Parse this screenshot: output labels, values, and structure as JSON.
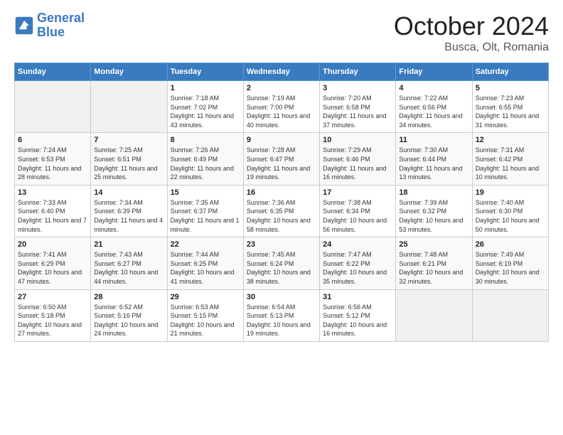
{
  "header": {
    "logo_line1": "General",
    "logo_line2": "Blue",
    "title": "October 2024",
    "subtitle": "Busca, Olt, Romania"
  },
  "days_of_week": [
    "Sunday",
    "Monday",
    "Tuesday",
    "Wednesday",
    "Thursday",
    "Friday",
    "Saturday"
  ],
  "weeks": [
    [
      {
        "num": "",
        "info": ""
      },
      {
        "num": "",
        "info": ""
      },
      {
        "num": "1",
        "info": "Sunrise: 7:18 AM\nSunset: 7:02 PM\nDaylight: 11 hours and 43 minutes."
      },
      {
        "num": "2",
        "info": "Sunrise: 7:19 AM\nSunset: 7:00 PM\nDaylight: 11 hours and 40 minutes."
      },
      {
        "num": "3",
        "info": "Sunrise: 7:20 AM\nSunset: 6:58 PM\nDaylight: 11 hours and 37 minutes."
      },
      {
        "num": "4",
        "info": "Sunrise: 7:22 AM\nSunset: 6:56 PM\nDaylight: 11 hours and 34 minutes."
      },
      {
        "num": "5",
        "info": "Sunrise: 7:23 AM\nSunset: 6:55 PM\nDaylight: 11 hours and 31 minutes."
      }
    ],
    [
      {
        "num": "6",
        "info": "Sunrise: 7:24 AM\nSunset: 6:53 PM\nDaylight: 11 hours and 28 minutes."
      },
      {
        "num": "7",
        "info": "Sunrise: 7:25 AM\nSunset: 6:51 PM\nDaylight: 11 hours and 25 minutes."
      },
      {
        "num": "8",
        "info": "Sunrise: 7:26 AM\nSunset: 6:49 PM\nDaylight: 11 hours and 22 minutes."
      },
      {
        "num": "9",
        "info": "Sunrise: 7:28 AM\nSunset: 6:47 PM\nDaylight: 11 hours and 19 minutes."
      },
      {
        "num": "10",
        "info": "Sunrise: 7:29 AM\nSunset: 6:46 PM\nDaylight: 11 hours and 16 minutes."
      },
      {
        "num": "11",
        "info": "Sunrise: 7:30 AM\nSunset: 6:44 PM\nDaylight: 11 hours and 13 minutes."
      },
      {
        "num": "12",
        "info": "Sunrise: 7:31 AM\nSunset: 6:42 PM\nDaylight: 11 hours and 10 minutes."
      }
    ],
    [
      {
        "num": "13",
        "info": "Sunrise: 7:33 AM\nSunset: 6:40 PM\nDaylight: 11 hours and 7 minutes."
      },
      {
        "num": "14",
        "info": "Sunrise: 7:34 AM\nSunset: 6:39 PM\nDaylight: 11 hours and 4 minutes."
      },
      {
        "num": "15",
        "info": "Sunrise: 7:35 AM\nSunset: 6:37 PM\nDaylight: 11 hours and 1 minute."
      },
      {
        "num": "16",
        "info": "Sunrise: 7:36 AM\nSunset: 6:35 PM\nDaylight: 10 hours and 58 minutes."
      },
      {
        "num": "17",
        "info": "Sunrise: 7:38 AM\nSunset: 6:34 PM\nDaylight: 10 hours and 56 minutes."
      },
      {
        "num": "18",
        "info": "Sunrise: 7:39 AM\nSunset: 6:32 PM\nDaylight: 10 hours and 53 minutes."
      },
      {
        "num": "19",
        "info": "Sunrise: 7:40 AM\nSunset: 6:30 PM\nDaylight: 10 hours and 50 minutes."
      }
    ],
    [
      {
        "num": "20",
        "info": "Sunrise: 7:41 AM\nSunset: 6:29 PM\nDaylight: 10 hours and 47 minutes."
      },
      {
        "num": "21",
        "info": "Sunrise: 7:43 AM\nSunset: 6:27 PM\nDaylight: 10 hours and 44 minutes."
      },
      {
        "num": "22",
        "info": "Sunrise: 7:44 AM\nSunset: 6:25 PM\nDaylight: 10 hours and 41 minutes."
      },
      {
        "num": "23",
        "info": "Sunrise: 7:45 AM\nSunset: 6:24 PM\nDaylight: 10 hours and 38 minutes."
      },
      {
        "num": "24",
        "info": "Sunrise: 7:47 AM\nSunset: 6:22 PM\nDaylight: 10 hours and 35 minutes."
      },
      {
        "num": "25",
        "info": "Sunrise: 7:48 AM\nSunset: 6:21 PM\nDaylight: 10 hours and 32 minutes."
      },
      {
        "num": "26",
        "info": "Sunrise: 7:49 AM\nSunset: 6:19 PM\nDaylight: 10 hours and 30 minutes."
      }
    ],
    [
      {
        "num": "27",
        "info": "Sunrise: 6:50 AM\nSunset: 5:18 PM\nDaylight: 10 hours and 27 minutes."
      },
      {
        "num": "28",
        "info": "Sunrise: 6:52 AM\nSunset: 5:16 PM\nDaylight: 10 hours and 24 minutes."
      },
      {
        "num": "29",
        "info": "Sunrise: 6:53 AM\nSunset: 5:15 PM\nDaylight: 10 hours and 21 minutes."
      },
      {
        "num": "30",
        "info": "Sunrise: 6:54 AM\nSunset: 5:13 PM\nDaylight: 10 hours and 19 minutes."
      },
      {
        "num": "31",
        "info": "Sunrise: 6:56 AM\nSunset: 5:12 PM\nDaylight: 10 hours and 16 minutes."
      },
      {
        "num": "",
        "info": ""
      },
      {
        "num": "",
        "info": ""
      }
    ]
  ]
}
